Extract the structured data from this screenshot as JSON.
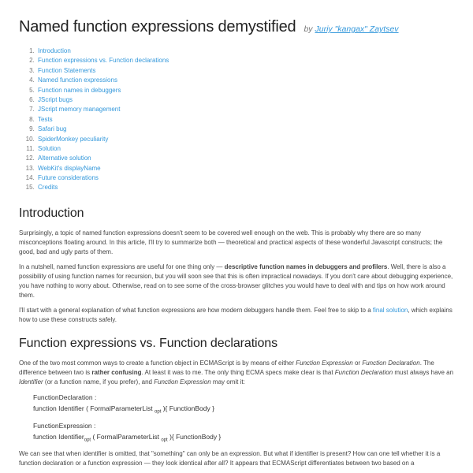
{
  "header": {
    "title": "Named function expressions demystified",
    "by": "by ",
    "author": "Juriy \"kangax\" Zaytsev"
  },
  "toc": [
    "Introduction",
    "Function expressions vs. Function declarations",
    "Function Statements",
    "Named function expressions",
    "Function names in debuggers",
    "JScript bugs",
    "JScript memory management",
    "Tests",
    "Safari bug",
    "SpiderMonkey peculiarity",
    "Solution",
    "Alternative solution",
    "WebKit's displayName",
    "Future considerations",
    "Credits"
  ],
  "sections": {
    "intro": {
      "heading": "Introduction",
      "p1": "Surprisingly, a topic of named function expressions doesn't seem to be covered well enough on the web. This is probably why there are so many misconceptions floating around. In this article, I'll try to summarize both — theoretical and practical aspects of these wonderful Javascript constructs; the good, bad and ugly parts of them.",
      "p2a": "In a nutshell, named function expressions are useful for one thing only — ",
      "p2b_bold": "descriptive function names in debuggers and profilers",
      "p2c": ". Well, there is also a possibility of using function names for recursion, but you will soon see that this is often impractical nowadays. If you don't care about debugging experience, you have nothing to worry about. Otherwise, read on to see some of the cross-browser glitches you would have to deal with and tips on how work around them.",
      "p3a": "I'll start with a general explanation of what function expressions are how modern debuggers handle them. Feel free to skip to a ",
      "p3_link": "final solution",
      "p3b": ", which explains how to use these constructs safely."
    },
    "fevd": {
      "heading": "Function expressions vs. Function declarations",
      "p1a": "One of the two most common ways to create a function object in ECMAScript is by means of either ",
      "p1_fe": "Function Expression",
      "p1b": " or ",
      "p1_fd": "Function Declaration",
      "p1c": ". The difference between two is ",
      "p1_bold": "rather confusing",
      "p1d": ". At least it was to me. The only thing ECMA specs make clear is that ",
      "p1_fd2": "Function Declaration",
      "p1e": " must always have an ",
      "p1_id": "Identifier",
      "p1f": " (or a function name, if you prefer), and ",
      "p1_fe2": "Function Expression",
      "p1g": " may omit it:",
      "grammar": {
        "l1": "FunctionDeclaration :",
        "l2a": "function Identifier ( FormalParameterList ",
        "l2b": " ){ FunctionBody }",
        "l3": "FunctionExpression :",
        "l4a": "function Identifier",
        "l4b": " ( FormalParameterList ",
        "l4c": " ){ FunctionBody }",
        "opt": "opt"
      },
      "p2": "We can see that when identifier is omitted, that \"something\" can only be an expression. But what if identifier is present? How can one tell whether it is a function declaration or a function expression — they look identical after all? It appears that ECMAScript differentiates between two based on a"
    }
  }
}
